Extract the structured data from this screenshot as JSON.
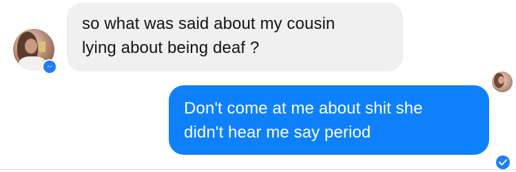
{
  "thread": {
    "incoming": {
      "lines": [
        "so what was said about my cousin",
        "lying about being deaf ?"
      ],
      "badge_icon": "messenger-icon"
    },
    "outgoing": {
      "lines": [
        "Don't come at me about shit she",
        "didn't hear me say period"
      ],
      "status_icon": "delivered-check-icon"
    },
    "seen_indicator": "seen-avatar"
  },
  "colors": {
    "incoming_bubble": "#f1f0f0",
    "incoming_text": "#141414",
    "outgoing_bubble": "#0e80fb",
    "outgoing_text": "#ffffff",
    "accent": "#1d7df5",
    "background": "#ffffff"
  }
}
